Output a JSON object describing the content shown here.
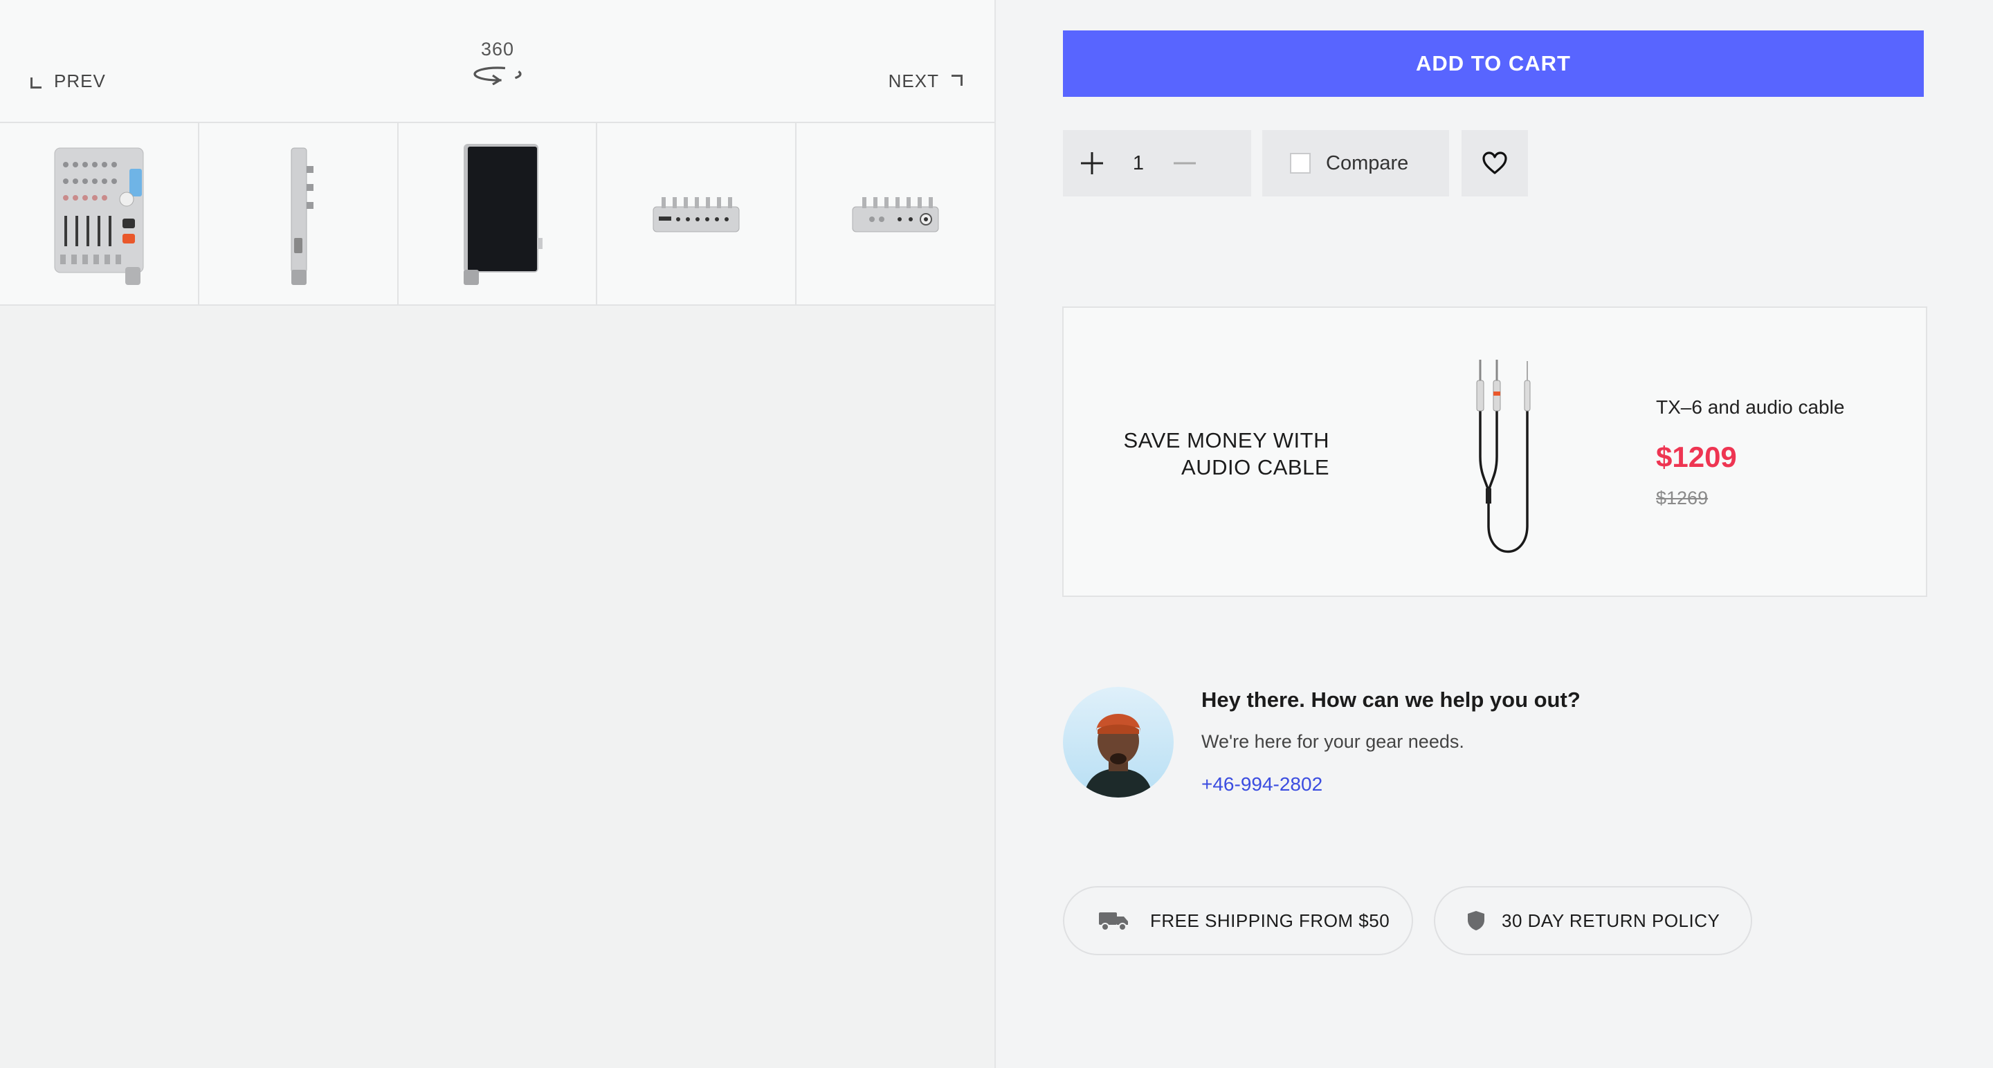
{
  "gallery": {
    "prev_label": "PREV",
    "next_label": "NEXT",
    "spin_label": "360",
    "thumbnails": [
      {
        "view": "front"
      },
      {
        "view": "side"
      },
      {
        "view": "back"
      },
      {
        "view": "top"
      },
      {
        "view": "bottom"
      }
    ]
  },
  "purchase": {
    "add_to_cart_label": "ADD TO CART",
    "quantity": "1",
    "compare_label": "Compare"
  },
  "bundle": {
    "headline": "SAVE MONEY WITH AUDIO CABLE",
    "name": "TX–6 and audio cable",
    "price": "$1209",
    "old_price": "$1269"
  },
  "help": {
    "title": "Hey there. How can we help you out?",
    "subtitle": "We're here for your gear needs.",
    "phone": "+46-994-2802"
  },
  "badges": {
    "shipping": "FREE SHIPPING FROM $50",
    "returns": "30 DAY RETURN POLICY"
  },
  "colors": {
    "accent": "#5865ff",
    "price": "#ee3552",
    "link": "#3b4de0"
  }
}
